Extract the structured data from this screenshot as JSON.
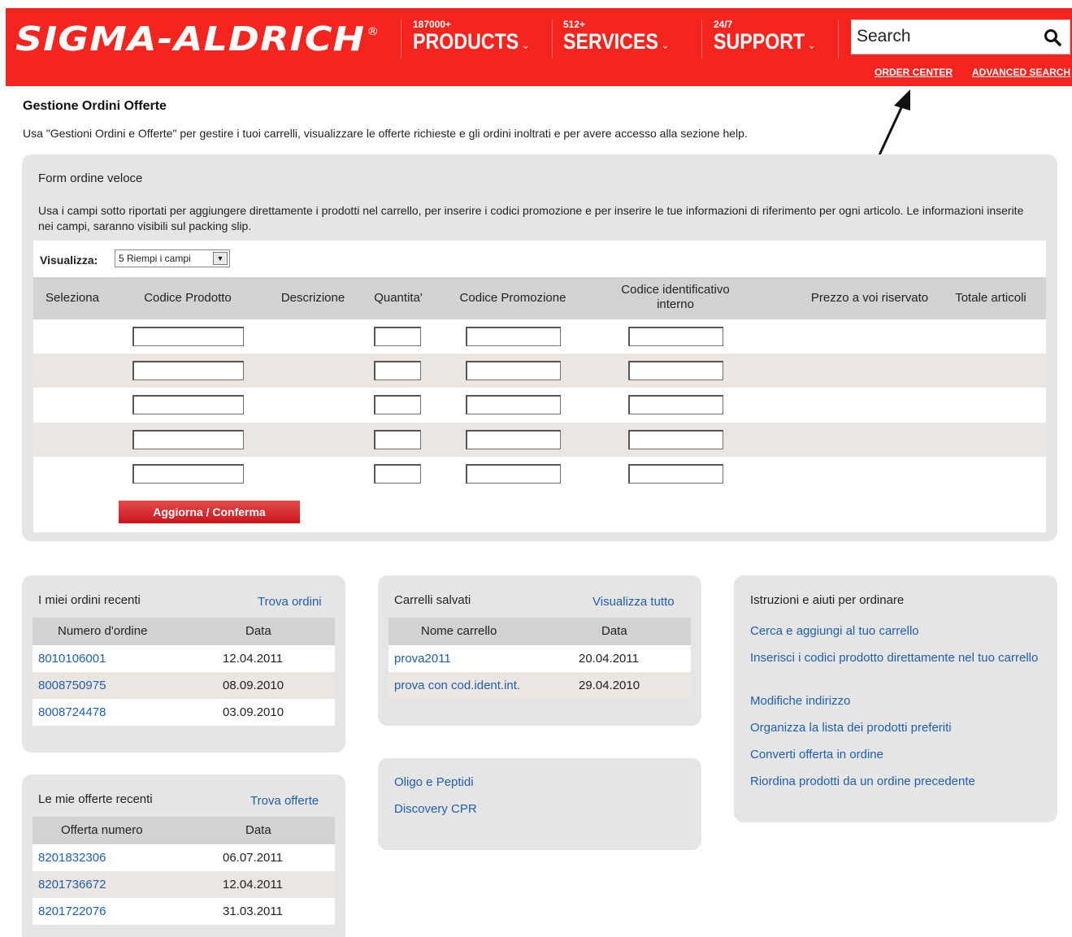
{
  "header": {
    "logo": "SIGMA-ALDRICH",
    "logo_mark": "®",
    "nav": [
      {
        "small": "187000+",
        "label": "PRODUCTS"
      },
      {
        "small": "512+",
        "label": "SERVICES"
      },
      {
        "small": "24/7",
        "label": "SUPPORT"
      }
    ],
    "search_placeholder": "Search",
    "links": {
      "order_center": "ORDER CENTER",
      "advanced_search": "ADVANCED SEARCH"
    }
  },
  "page": {
    "title": "Gestione Ordini Offerte",
    "intro": "Usa \"Gestioni Ordini e Offerte\" per gestire i tuoi carrelli, visualizzare le offerte richieste e gli ordini inoltrati e per avere accesso alla sezione help."
  },
  "quick_form": {
    "title": "Form ordine veloce",
    "description": "Usa i campi sotto riportati per aggiungere direttamente i prodotti nel carrello, per inserire i codici promozione e per inserire le tue informazioni di riferimento per ogni articolo. Le informazioni inserite nei campi, saranno visibili sul packing slip.",
    "view_label": "Visualizza:",
    "view_value": "5 Riempi i campi",
    "columns": [
      "Seleziona",
      "Codice Prodotto",
      "Descrizione",
      "Quantita'",
      "Codice Promozione",
      "Codice identificativo interno",
      "Prezzo a voi riservato",
      "Totale articoli"
    ],
    "button": "Aggiorna / Conferma"
  },
  "recent_orders": {
    "title": "I miei ordini recenti",
    "link": "Trova ordini",
    "columns": [
      "Numero d'ordine",
      "Data"
    ],
    "rows": [
      {
        "id": "8010106001",
        "date": "12.04.2011"
      },
      {
        "id": "8008750975",
        "date": "08.09.2010"
      },
      {
        "id": "8008724478",
        "date": "03.09.2010"
      }
    ]
  },
  "recent_quotes": {
    "title": "Le mie offerte recenti",
    "link": "Trova offerte",
    "columns": [
      "Offerta numero",
      "Data"
    ],
    "rows": [
      {
        "id": "8201832306",
        "date": "06.07.2011"
      },
      {
        "id": "8201736672",
        "date": "12.04.2011"
      },
      {
        "id": "8201722076",
        "date": "31.03.2011"
      }
    ]
  },
  "saved_carts": {
    "title": "Carrelli salvati",
    "link": "Visualizza tutto",
    "columns": [
      "Nome carrello",
      "Data"
    ],
    "rows": [
      {
        "name": "prova2011",
        "date": "20.04.2011"
      },
      {
        "name": "prova con cod.ident.int.",
        "date": "29.04.2010"
      }
    ]
  },
  "other_links": [
    "Oligo e Peptidi",
    "Discovery CPR"
  ],
  "help": {
    "title": "Istruzioni e aiuti per ordinare",
    "links": [
      "Cerca e aggiungi al tuo carrello",
      "Inserisci i codici prodotto direttamente nel tuo carrello",
      "Modifiche indirizzo",
      "Organizza la lista dei prodotti preferiti",
      "Converti offerta in ordine",
      "Riordina prodotti da un ordine precedente"
    ]
  }
}
